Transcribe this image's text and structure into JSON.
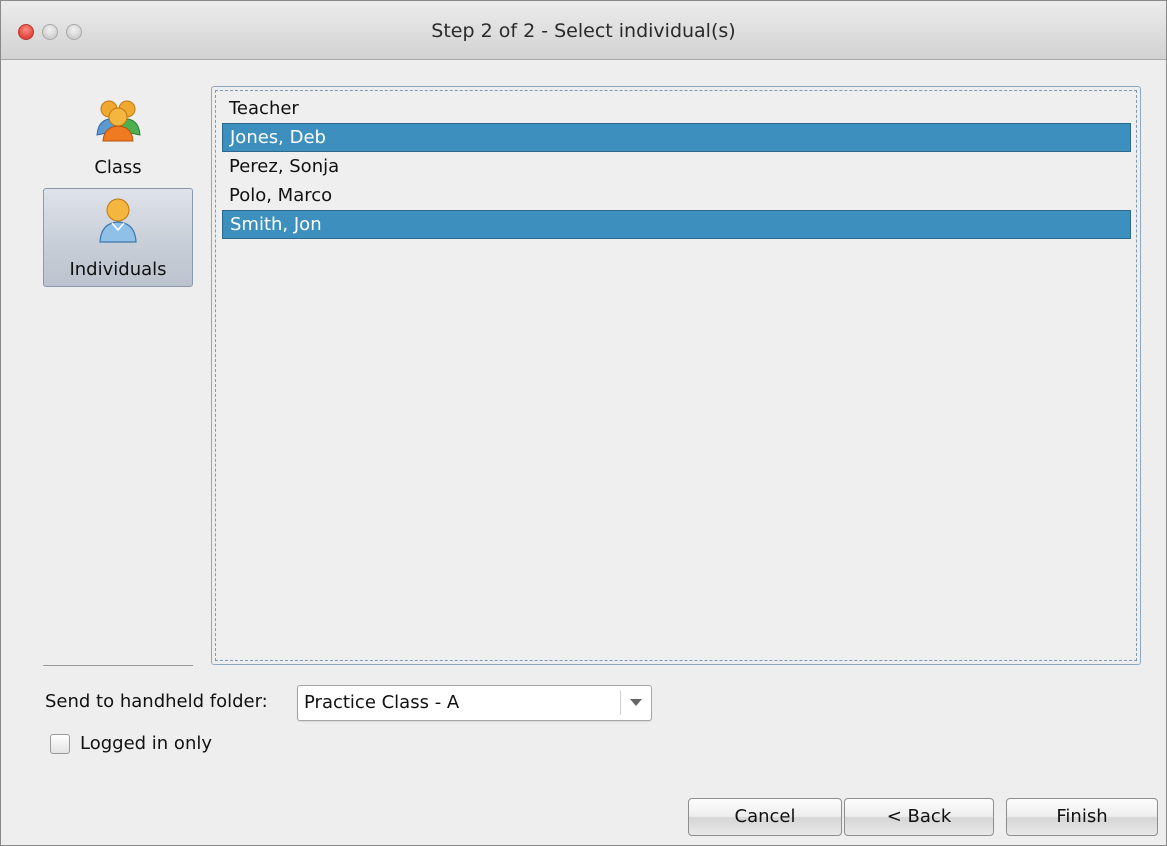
{
  "window": {
    "title": "Step 2 of 2 - Select individual(s)"
  },
  "nav": {
    "items": [
      {
        "label": "Class",
        "icon": "group-users-icon",
        "selected": false
      },
      {
        "label": "Individuals",
        "icon": "single-user-icon",
        "selected": true
      }
    ]
  },
  "list": {
    "items": [
      {
        "label": "Teacher",
        "selected": false
      },
      {
        "label": "Jones, Deb",
        "selected": true
      },
      {
        "label": "Perez, Sonja",
        "selected": false
      },
      {
        "label": "Polo, Marco",
        "selected": false
      },
      {
        "label": "Smith, Jon",
        "selected": true
      }
    ]
  },
  "folder": {
    "label": "Send to handheld folder:",
    "value": "Practice Class - A"
  },
  "logged_in": {
    "label": "Logged in only",
    "checked": false
  },
  "buttons": {
    "cancel": "Cancel",
    "back": "< Back",
    "finish": "Finish"
  },
  "colors": {
    "selection": "#3d90bd",
    "window_bg": "#eeeeee"
  }
}
